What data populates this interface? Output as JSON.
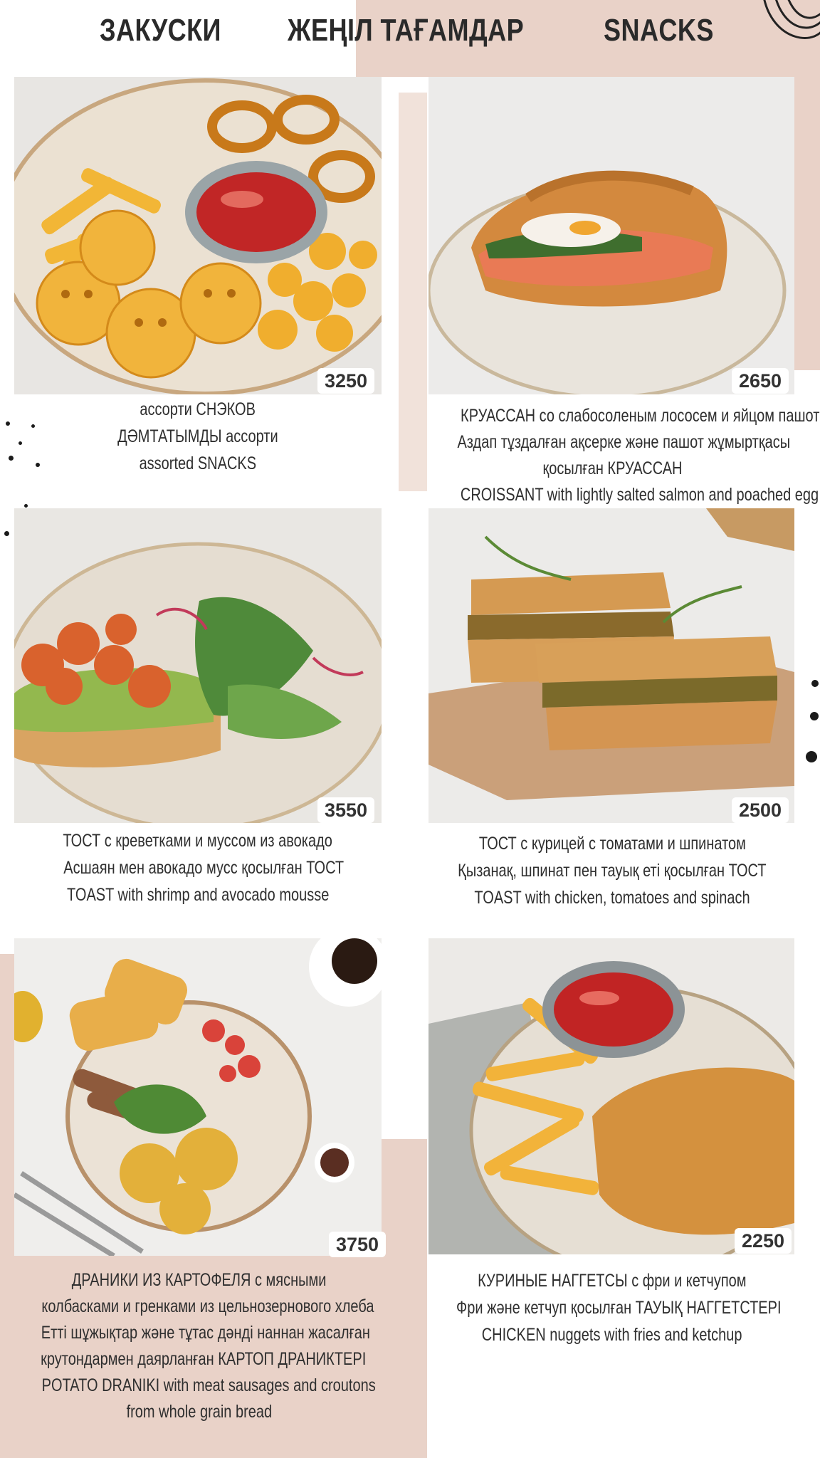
{
  "header": {
    "title_ru": "ЗАКУСКИ",
    "title_kz": "ЖЕҢІЛ ТАҒАМДАР",
    "title_en": "SNACKS"
  },
  "colors": {
    "accent_pink": "#e9d2c8",
    "text": "#2f2f2f",
    "price_bg": "#ffffff"
  },
  "items": [
    {
      "price": "3250",
      "lines": [
        "ассорти СНЭКОВ",
        "ДӘМТАТЫМДЫ ассорти",
        "assorted SNACKS"
      ]
    },
    {
      "price": "2650",
      "lines": [
        "КРУАССАН со слабосоленым лососем и яйцом пашот",
        "Аздап тұздалған ақсерке және пашот жұмыртқасы",
        "қосылған КРУАССАН",
        "CROISSANT with lightly salted salmon and poached egg"
      ]
    },
    {
      "price": "3550",
      "lines": [
        "ТОСТ с креветками и муссом из авокадо",
        "Асшаян мен авокадо мусс қосылған ТОСТ",
        "TOAST with shrimp and avocado mousse"
      ]
    },
    {
      "price": "2500",
      "lines": [
        "ТОСТ с курицей с томатами и шпинатом",
        "Қызанақ, шпинат пен тауық еті қосылған ТОСТ",
        "TOAST with chicken, tomatoes and spinach"
      ]
    },
    {
      "price": "3750",
      "lines": [
        "ДРАНИКИ ИЗ КАРТОФЕЛЯ с мясными",
        "колбасками и гренками из цельнозернового хлеба",
        "Етті шұжықтар және тұтас дәнді наннан жасалған",
        "крутондармен даярланған КАРТОП ДРАНИКТЕРІ",
        "POTATO DRANIKI with meat sausages and croutons",
        "from whole grain bread"
      ]
    },
    {
      "price": "2250",
      "lines": [
        "КУРИНЫЕ НАГГЕТСЫ с фри и кетчупом",
        "Фри және кетчуп қосылған ТАУЫҚ НАГГЕТСТЕРІ",
        "CHICKEN nuggets with fries and ketchup"
      ]
    }
  ]
}
